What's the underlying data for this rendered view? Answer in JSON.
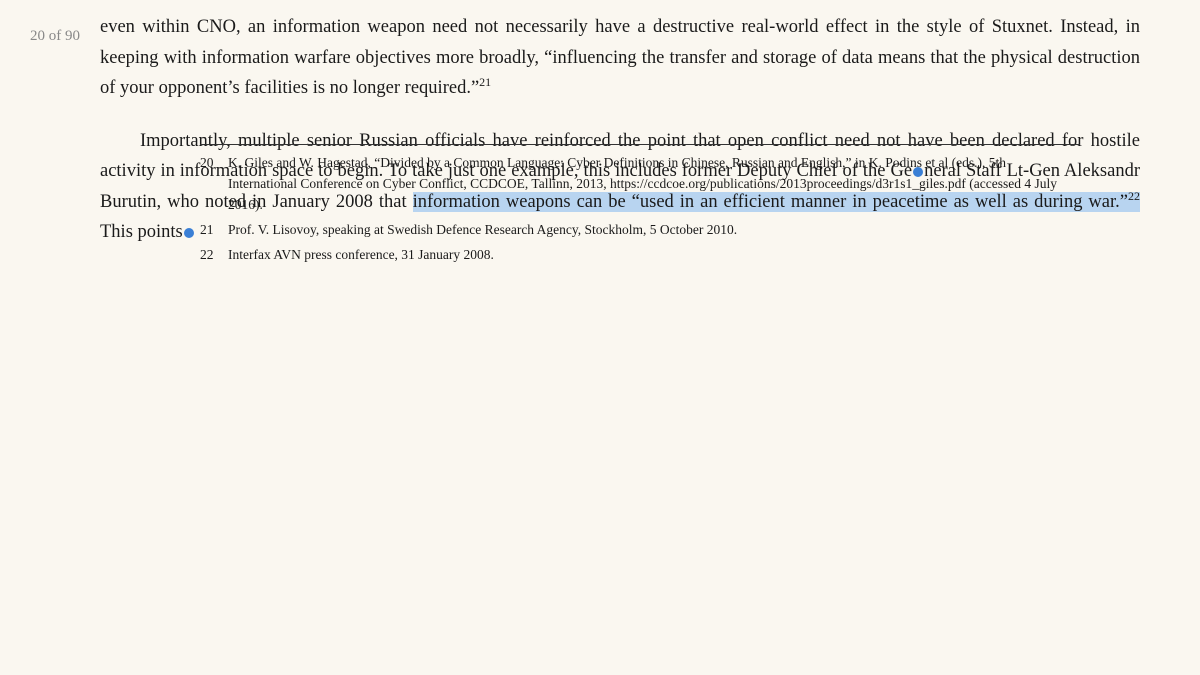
{
  "page": {
    "page_number": "20 of 90",
    "background_color": "#faf7f0"
  },
  "paragraphs": [
    {
      "id": "para1",
      "text_before_highlight": "even within CNO, an information weapon need not necessarily have a destructive real-world effect in the style of Stuxnet. Instead, in keeping with information warfare objectives more broadly, “influencing the transfer and storage of data means that the physical destruction of your opponent’s facilities is no longer required.”",
      "superscript": "21",
      "text_after_highlight": "",
      "has_indent": false
    },
    {
      "id": "para2",
      "text_before_dot1": "Importantly, multiple senior Russian officials have reinforced the point that open conflict need not have been declared for hostile activity in information space to begin. To take just one example, this includes former Deputy Chief of the Ge",
      "dot1": true,
      "text_between_dots": "neral Staff Lt-Gen Aleksandr Burutin, who noted in January 2008 that ",
      "highlight_text": "information weapons can be “used in an efficient manner in peacetime as well as during war.”",
      "superscript_in_highlight": "22",
      "text_after_highlight": " This points",
      "dot2": true,
      "has_indent": true
    }
  ],
  "footnotes": [
    {
      "number": "20",
      "text": "K. Giles and W. Hagestad, “Divided by a Common Language: Cyber Definitions in Chinese, Russian and English,” in K. Podins et al (eds.), 5th International Conference on Cyber Conflict, CCDCOE, Tallinn, 2013, https://ccdcoe.org/publications/2013proceedings/d3r1s1_giles.pdf (accessed 4 July 2016)."
    },
    {
      "number": "21",
      "text": "Prof. V. Lisovoy, speaking at Swedish Defence Research Agency, Stockholm, 5 October 2010."
    },
    {
      "number": "22",
      "text": "Interfax AVN press conference, 31 January 2008."
    }
  ]
}
